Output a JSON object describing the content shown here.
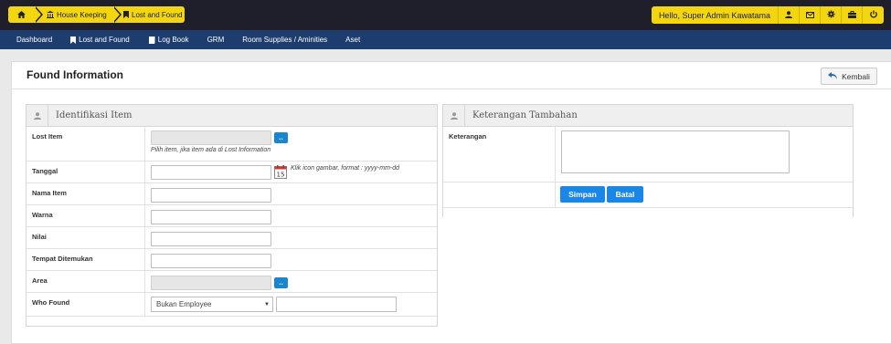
{
  "breadcrumb": {
    "home_icon": "home-icon",
    "items": [
      {
        "label": "House Keeping",
        "icon": "building-icon"
      },
      {
        "label": "Lost and Found",
        "icon": "bookmark-icon"
      }
    ]
  },
  "userbar": {
    "greeting": "Hello, Super Admin Kawatama",
    "icons": [
      "user-icon",
      "envelope-icon",
      "gear-icon",
      "briefcase-icon",
      "power-icon"
    ]
  },
  "nav": {
    "items": [
      {
        "label": "Dashboard",
        "icon": ""
      },
      {
        "label": "Lost and Found",
        "icon": "bookmark-icon"
      },
      {
        "label": "Log Book",
        "icon": "book-icon"
      },
      {
        "label": "GRM",
        "icon": ""
      },
      {
        "label": "Room Supplies / Aminities",
        "icon": ""
      },
      {
        "label": "Aset",
        "icon": ""
      }
    ]
  },
  "page": {
    "title": "Found Information",
    "back_label": "Kembali"
  },
  "identifikasi": {
    "title": "Identifikasi Item",
    "lost_item_label": "Lost Item",
    "lost_item_hint": "Pilih item, jika item ada di Lost Information",
    "browse_label": "..",
    "tanggal_label": "Tanggal",
    "tanggal_hint": "Klik icon gambar, format : yyyy-mm-dd",
    "nama_item_label": "Nama Item",
    "warna_label": "Warna",
    "nilai_label": "Nilai",
    "tempat_label": "Tempat Ditemukan",
    "area_label": "Area",
    "who_found_label": "Who Found",
    "who_found_selected": "Bukan Employee"
  },
  "keterangan": {
    "title": "Keterangan Tambahan",
    "field_label": "Keterangan",
    "save_label": "Simpan",
    "cancel_label": "Batal"
  },
  "colors": {
    "accent_yellow": "#f3d60f",
    "topbar": "#1f1f2b",
    "navbar": "#1c3d6e",
    "button_blue": "#1a86e8"
  }
}
